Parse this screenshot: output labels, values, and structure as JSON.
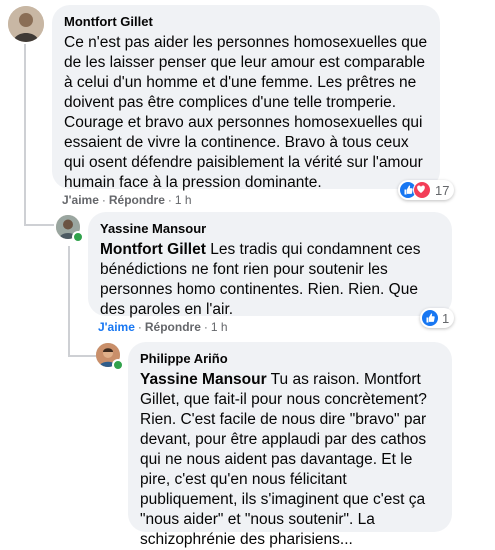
{
  "comments": [
    {
      "author": "Montfort Gillet",
      "mention": "",
      "text": "Ce n'est pas aider les personnes homosexuelles que de les laisser penser que leur amour est comparable à celui d'un homme et d'une femme. Les prêtres ne doivent pas être complices d'une telle tromperie. Courage et bravo aux personnes homosexuelles qui essaient de vivre la continence. Bravo à tous ceux qui osent défendre paisiblement la vérité sur l'amour humain face à la pression dominante.",
      "like_label": "J'aime",
      "reply_label": "Répondre",
      "time": "1 h",
      "reaction_count": "17"
    },
    {
      "author": "Yassine Mansour",
      "mention": "Montfort Gillet",
      "text": " Les tradis qui condamnent ces bénédictions ne font rien pour soutenir les personnes homo continentes. Rien. Rien. Que des paroles en l'air.",
      "like_label": "J'aime",
      "reply_label": "Répondre",
      "time": "1 h",
      "reaction_count": "1"
    },
    {
      "author": "Philippe Ariño",
      "mention": "Yassine Mansour",
      "text": " Tu as raison. Montfort Gillet, que fait-il pour nous concrètement? Rien. C'est facile de nous dire \"bravo\" par devant, pour être applaudi par des cathos qui ne nous aident pas davantage. Et le pire, c'est qu'en nous félicitant publiquement, ils s'imaginent que c'est ça \"nous aider\" et \"nous soutenir\". La schizophrénie des pharisiens..."
    }
  ],
  "separator": "·",
  "colors": {
    "accent": "#1877f2",
    "bubble": "#f0f2f5",
    "love": "#f33e58",
    "online": "#31a24c"
  }
}
